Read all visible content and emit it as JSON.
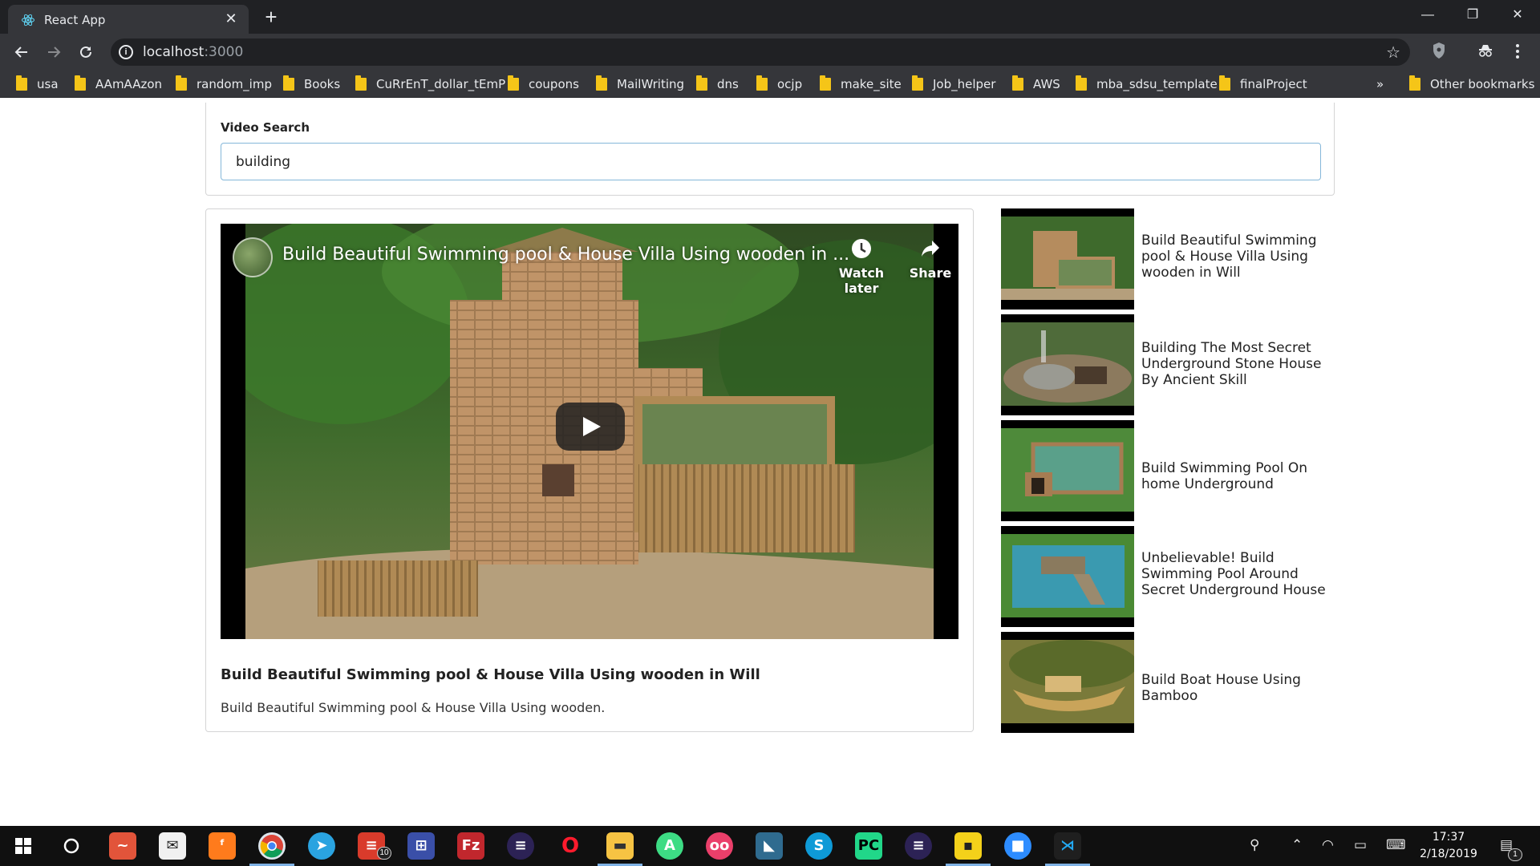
{
  "browser": {
    "tab_title": "React App",
    "tab_close": "✕",
    "new_tab": "+",
    "url_host": "localhost",
    "url_port": ":3000",
    "window_controls": [
      "—",
      "❐",
      "✕"
    ],
    "bookmarks": [
      "usa",
      "AAmAAzon",
      "random_imp",
      "Books",
      "CuRrEnT_dollar_tEmP",
      "coupons",
      "MailWriting",
      "dns",
      "ocjp",
      "make_site",
      "Job_helper",
      "AWS",
      "mba_sdsu_template",
      "finalProject"
    ],
    "bookmarks_overflow": "»",
    "other_bookmarks": "Other bookmarks"
  },
  "search": {
    "label": "Video Search",
    "value": "building"
  },
  "selected_video": {
    "player_title": "Build Beautiful Swimming pool & House Villa Using wooden in ...",
    "watch_later": "Watch later",
    "share": "Share",
    "title": "Build Beautiful Swimming pool & House Villa Using wooden in Will",
    "description": "Build Beautiful Swimming pool & House Villa Using wooden."
  },
  "video_list": [
    {
      "title": "Build Beautiful Swimming pool & House Villa Using wooden in Will"
    },
    {
      "title": "Building The Most Secret Underground Stone House By Ancient Skill"
    },
    {
      "title": "Build Swimming Pool On home Underground"
    },
    {
      "title": "Unbelievable! Build Swimming Pool Around Secret Underground House"
    },
    {
      "title": "Build Boat House Using Bamboo"
    }
  ],
  "taskbar": {
    "badge_count": "10",
    "time": "17:37",
    "date": "2/18/2019",
    "notification_count": "1"
  },
  "colors": {
    "chrome_dark": "#202124",
    "chrome_toolbar": "#35363a",
    "input_focus_border": "#85b7d9",
    "card_border": "#d4d4d5",
    "folder_yellow": "#f5c518"
  }
}
